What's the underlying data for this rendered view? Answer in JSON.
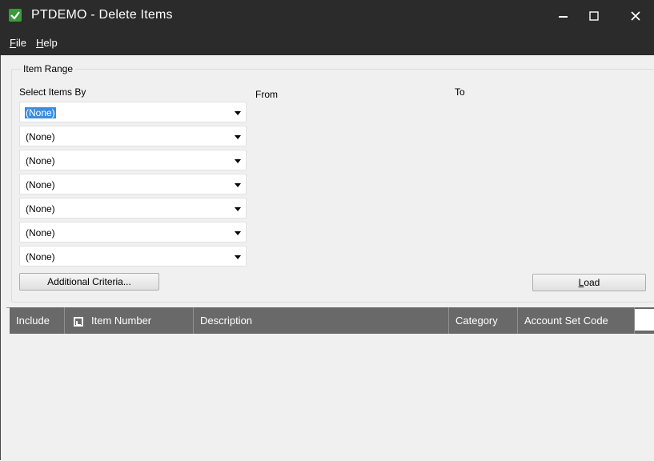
{
  "window": {
    "title": "PTDEMO - Delete Items",
    "colors": {
      "titlebar": "#2b2b2b",
      "grid_header": "#696969",
      "selection": "#3a8de0"
    },
    "icons": {
      "app": "shield-check-icon",
      "minimize": "minimize-icon",
      "maximize": "maximize-icon",
      "close": "close-icon"
    }
  },
  "menu": {
    "file": {
      "mnemonic": "F",
      "rest": "ile"
    },
    "help": {
      "mnemonic": "H",
      "rest": "elp"
    }
  },
  "item_range": {
    "legend": "Item Range",
    "select_by_label": "Select Items By",
    "from_label": "From",
    "to_label": "To",
    "selectors": [
      "(None)",
      "(None)",
      "(None)",
      "(None)",
      "(None)",
      "(None)",
      "(None)"
    ],
    "additional_criteria_label": "Additional Criteria...",
    "load": {
      "mnemonic": "L",
      "rest": "oad"
    }
  },
  "grid": {
    "columns": {
      "include": "Include",
      "item_number": "Item Number",
      "description": "Description",
      "category": "Category",
      "account_set_code": "Account Set Code"
    },
    "rows": []
  }
}
